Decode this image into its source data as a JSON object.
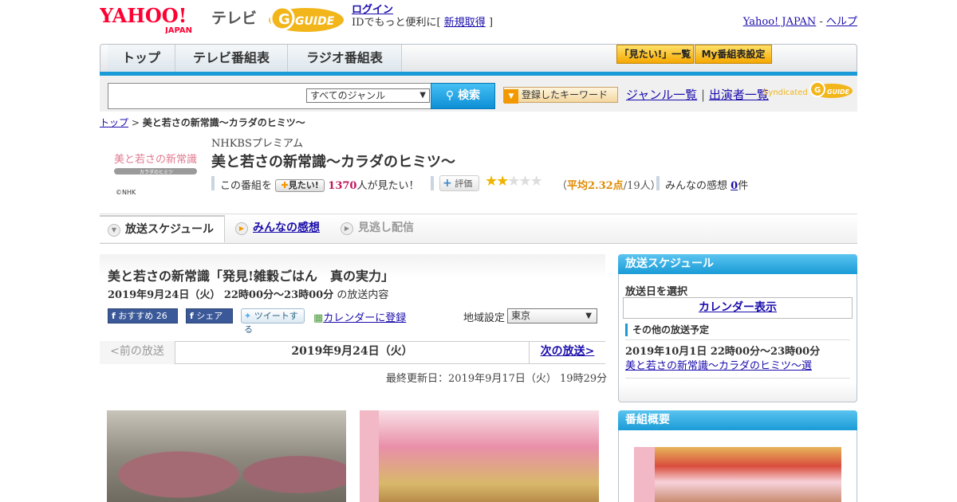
{
  "header": {
    "logo_yahoo": "YAHOO!",
    "logo_japan": "JAPAN",
    "logo_tv": "テレビ",
    "logo_gguide": "GUIDE",
    "login": "ログイン",
    "login_note_prefix": "IDでもっと便利に[",
    "signup": "新規取得",
    "login_note_suffix": "]",
    "yahoo_japan_link": "Yahoo! JAPAN",
    "link_sep": " - ",
    "help_link": "ヘルプ"
  },
  "nav": {
    "tabs": [
      "トップ",
      "テレビ番組表",
      "ラジオ番組表"
    ],
    "mitai_list": "「見たい!」一覧",
    "my_schedule": "My番組表設定"
  },
  "search": {
    "input_value": "",
    "genre_selected": "すべてのジャンル",
    "button": "検索",
    "registered_keyword": "登録したキーワード",
    "genre_list": "ジャンル一覧",
    "sep": "|",
    "performer_list": "出演者一覧",
    "syndicated": "Syndicated"
  },
  "breadcrumb": {
    "top": "トップ",
    "sep": " > ",
    "current": "美と若さの新常識～カラダのヒミツ～"
  },
  "program": {
    "logo_text": "美と若さの新常識",
    "logo_sub": "カラダのヒミツ",
    "logo_copy": "©NHK",
    "channel": "NHKBSプレミアム",
    "title": "美と若さの新常識～カラダのヒミツ～",
    "want_prefix": "この番組を",
    "want_button": "見たい!",
    "want_count": "1370",
    "want_suffix": "人が見たい！",
    "rate_button": "評価",
    "rating": 2.32,
    "avg_open": "（",
    "avg_label": "平均2.32点",
    "avg_count": "/19人）",
    "comments_label": "みんなの感想",
    "comments_count": "0",
    "comments_unit": "件"
  },
  "subtabs": [
    "放送スケジュール",
    "みんなの感想",
    "見逃し配信"
  ],
  "episode": {
    "title": "美と若さの新常識「発見!雑穀ごはん　真の実力」",
    "time_bold": "2019年9月24日（火）  22時00分～23時00分",
    "time_suffix": " の放送内容",
    "fb_recommend": "おすすめ",
    "fb_count": "26",
    "fb_share": "シェア",
    "tweet": "ツイートする",
    "calendar": "カレンダーに登録",
    "region_label": "地域設定",
    "region_value": "東京",
    "prev": "<前の放送",
    "current_date": "2019年9月24日（火）",
    "next": "次の放送>",
    "updated": "最終更新日：2019年9月17日（火）  19時29分"
  },
  "sidebar": {
    "schedule_title": "放送スケジュール",
    "date_select": "放送日を選択",
    "calendar": "カレンダー表示",
    "other_label": "その他の放送予定",
    "other_time": "2019年10月1日  22時00分～23時00分",
    "other_link": "美と若さの新常識～カラダのヒミツ～選",
    "summary_title": "番組概要"
  },
  "colors": {
    "accent_blue": "#1a9bd7",
    "yahoo_red": "#ff0033",
    "gguide_yellow": "#f2b51a",
    "want_pink": "#c2185b"
  }
}
